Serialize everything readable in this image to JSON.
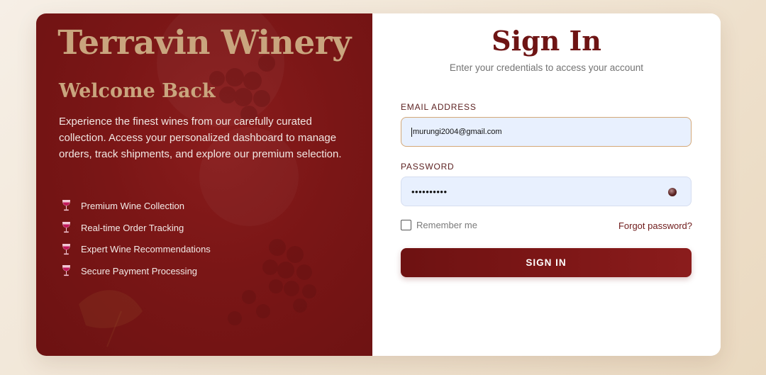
{
  "brand": {
    "name": "Terravin Winery"
  },
  "welcome": {
    "heading": "Welcome Back",
    "description": "Experience the finest wines from our carefully curated collection. Access your personalized dashboard to manage orders, track shipments, and explore our premium selection."
  },
  "features": [
    {
      "icon": "wine-glass-icon",
      "label": "Premium Wine Collection"
    },
    {
      "icon": "wine-glass-icon",
      "label": "Real-time Order Tracking"
    },
    {
      "icon": "wine-glass-icon",
      "label": "Expert Wine Recommendations"
    },
    {
      "icon": "wine-glass-icon",
      "label": "Secure Payment Processing"
    }
  ],
  "form": {
    "title": "Sign In",
    "subtitle": "Enter your credentials to access your account",
    "email_label": "EMAIL ADDRESS",
    "email_value": "murungi2004@gmail.com",
    "password_label": "PASSWORD",
    "password_value": "••••••••••",
    "remember_label": "Remember me",
    "remember_checked": false,
    "forgot_label": "Forgot password?",
    "submit_label": "SIGN IN"
  },
  "colors": {
    "primary": "#6e1414",
    "panel": "#7a1616",
    "gold": "#c9a57e",
    "input_bg": "#e8f0fe"
  }
}
